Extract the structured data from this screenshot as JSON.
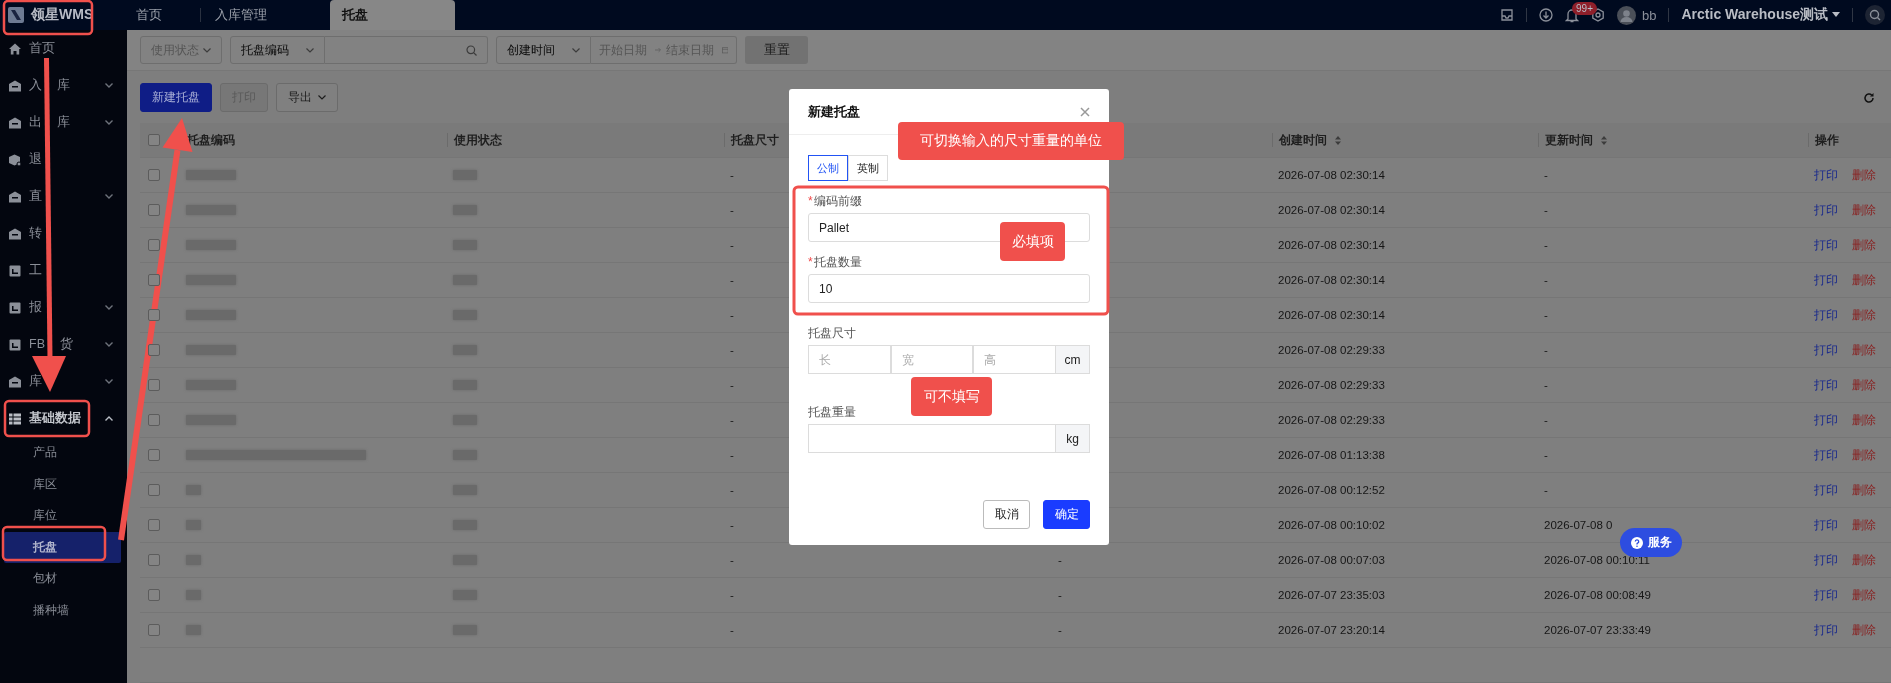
{
  "topbar": {
    "logo_text": "领星WMS",
    "tabs": [
      {
        "label": "首页",
        "selected": false
      },
      {
        "label": "入库管理",
        "selected": false
      },
      {
        "label": "托盘",
        "selected": true
      }
    ],
    "notification_badge": "99+",
    "user": "bb",
    "warehouse": "Arctic Warehouse测试"
  },
  "sidebar": {
    "items": [
      {
        "label": "首页",
        "kind": "link"
      },
      {
        "label": "入 库",
        "kind": "group",
        "expanded": false
      },
      {
        "label": "出 库",
        "kind": "group",
        "expanded": false
      },
      {
        "label": "退",
        "kind": "link"
      },
      {
        "label": "直",
        "kind": "group",
        "expanded": false
      },
      {
        "label": "转",
        "kind": "link"
      },
      {
        "label": "工",
        "kind": "link"
      },
      {
        "label": "报",
        "kind": "group",
        "expanded": false
      },
      {
        "label": "FB 货",
        "kind": "group",
        "expanded": false
      },
      {
        "label": "库",
        "kind": "group",
        "expanded": false
      },
      {
        "label": "基础数据",
        "kind": "group",
        "expanded": true,
        "children": [
          {
            "label": "产品",
            "selected": false
          },
          {
            "label": "库区",
            "selected": false
          },
          {
            "label": "库位",
            "selected": false
          },
          {
            "label": "托盘",
            "selected": true
          },
          {
            "label": "包材",
            "selected": false
          },
          {
            "label": "播种墙",
            "selected": false
          }
        ]
      }
    ]
  },
  "filters": {
    "status_select": {
      "placeholder": "使用状态"
    },
    "field_select": {
      "value": "托盘编码"
    },
    "date_type_select": {
      "value": "创建时间"
    },
    "date_range": {
      "start_placeholder": "开始日期",
      "end_placeholder": "结束日期"
    },
    "reset_button": "重置"
  },
  "toolbar": {
    "buttons": [
      {
        "label": "新建托盘",
        "kind": "primary"
      },
      {
        "label": "打印",
        "kind": "disabled"
      },
      {
        "label": "导出",
        "kind": "dropdown"
      }
    ]
  },
  "table": {
    "select_all_checked": false,
    "columns": [
      {
        "label": "托盘编码",
        "sortable": false
      },
      {
        "label": "使用状态",
        "sortable": false
      },
      {
        "label": "托盘尺寸",
        "sortable": false
      },
      {
        "label": "创建时间",
        "sortable": true
      },
      {
        "label": "更新时间",
        "sortable": true
      },
      {
        "label": "操作",
        "sortable": false
      }
    ],
    "rows": [
      {
        "checked": false,
        "size": "-",
        "created": "2026-07-08 02:30:14",
        "updated": "-",
        "actions": [
          "打印",
          "删除"
        ]
      },
      {
        "checked": false,
        "size": "-",
        "created": "2026-07-08 02:30:14",
        "updated": "-",
        "actions": [
          "打印",
          "删除"
        ]
      },
      {
        "checked": false,
        "size": "-",
        "created": "2026-07-08 02:30:14",
        "updated": "-",
        "actions": [
          "打印",
          "删除"
        ]
      },
      {
        "checked": false,
        "size": "-",
        "created": "2026-07-08 02:30:14",
        "updated": "-",
        "actions": [
          "打印",
          "删除"
        ]
      },
      {
        "checked": false,
        "size": "-",
        "created": "2026-07-08 02:30:14",
        "updated": "-",
        "actions": [
          "打印",
          "删除"
        ]
      },
      {
        "checked": false,
        "size": "-",
        "created": "2026-07-08 02:29:33",
        "updated": "-",
        "actions": [
          "打印",
          "删除"
        ]
      },
      {
        "checked": false,
        "size": "-",
        "created": "2026-07-08 02:29:33",
        "updated": "-",
        "actions": [
          "打印",
          "删除"
        ]
      },
      {
        "checked": false,
        "size": "-",
        "created": "2026-07-08 02:29:33",
        "updated": "-",
        "actions": [
          "打印",
          "删除"
        ]
      },
      {
        "checked": false,
        "size": "-",
        "created": "2026-07-08 01:13:38",
        "updated": "-",
        "actions": [
          "打印",
          "删除"
        ]
      },
      {
        "checked": false,
        "size": "-",
        "created": "2026-07-08 00:12:52",
        "updated": "-",
        "actions": [
          "打印",
          "删除"
        ]
      },
      {
        "checked": false,
        "size": "-",
        "created": "2026-07-08 00:10:02",
        "updated": "2026-07-08 0",
        "actions": [
          "打印",
          "删除"
        ]
      },
      {
        "checked": false,
        "size": "-",
        "column_4": "-",
        "created": "2026-07-08 00:07:03",
        "updated": "2026-07-08 00:10:11",
        "actions": [
          "打印",
          "删除"
        ]
      },
      {
        "checked": false,
        "size": "-",
        "column_4": "-",
        "created": "2026-07-07 23:35:03",
        "updated": "2026-07-08 00:08:49",
        "actions": [
          "打印",
          "删除"
        ]
      },
      {
        "checked": false,
        "size": "-",
        "column_4": "-",
        "created": "2026-07-07 23:20:14",
        "updated": "2026-07-07 23:33:49",
        "actions": [
          "打印",
          "删除"
        ]
      }
    ]
  },
  "modal": {
    "title": "新建托盘",
    "unit_tabs": [
      {
        "label": "公制",
        "selected": true
      },
      {
        "label": "英制",
        "selected": false
      }
    ],
    "fields": [
      {
        "kind": "text",
        "label": "编码前缀",
        "required_mark": "*",
        "value": "Pallet"
      },
      {
        "kind": "text",
        "label": "托盘数量",
        "required_mark": "*",
        "value": "10"
      },
      {
        "kind": "dimensions",
        "label": "托盘尺寸",
        "placeholders": [
          "长",
          "宽",
          "高"
        ],
        "unit": "cm"
      },
      {
        "kind": "unit",
        "label": "托盘重量",
        "unit": "kg"
      }
    ],
    "buttons": [
      {
        "label": "取消",
        "kind": "default"
      },
      {
        "label": "确定",
        "kind": "primary"
      }
    ]
  },
  "annotations": [
    "可切换输入的尺寸重量的单位",
    "必填项",
    "可不填写"
  ],
  "service_button": "服务"
}
